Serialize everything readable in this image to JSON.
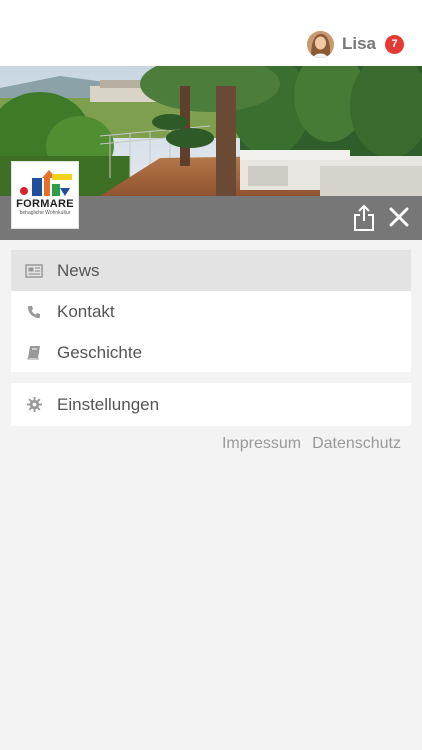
{
  "header": {
    "user_name": "Lisa",
    "notification_count": "7"
  },
  "logo": {
    "name": "FORMARE",
    "tagline": "behagliche Wohnkultur"
  },
  "menu": {
    "primary": [
      {
        "label": "News",
        "icon": "newspaper-icon",
        "active": true
      },
      {
        "label": "Kontakt",
        "icon": "phone-icon",
        "active": false
      },
      {
        "label": "Geschichte",
        "icon": "book-icon",
        "active": false
      }
    ],
    "secondary": [
      {
        "label": "Einstellungen",
        "icon": "gear-icon",
        "active": false
      }
    ]
  },
  "footer": {
    "impressum": "Impressum",
    "datenschutz": "Datenschutz"
  },
  "colors": {
    "action_bar": "#777777",
    "badge": "#e53935",
    "active_item": "#e3e3e3",
    "background": "#f3f3f3"
  }
}
